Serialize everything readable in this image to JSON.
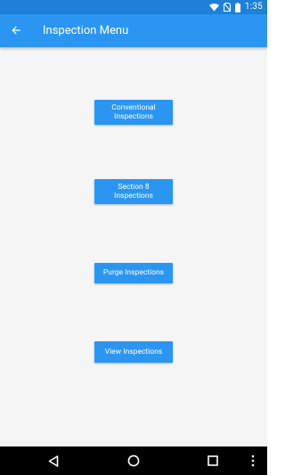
{
  "status_bar": {
    "time": "1:35",
    "icons": [
      "wifi-icon",
      "no-sim-icon",
      "battery-icon"
    ]
  },
  "app_bar": {
    "title": "Inspection Menu",
    "back_icon": "arrow-left-icon"
  },
  "menu": {
    "buttons": [
      {
        "label": "Conventional Inspections"
      },
      {
        "label": "Section 8 Inspections"
      },
      {
        "label": "Purge Inspections"
      },
      {
        "label": "View Inspections"
      }
    ]
  },
  "nav_bar": {
    "icons": [
      "back-triangle-icon",
      "home-circle-icon",
      "recents-square-icon",
      "more-vert-icon"
    ]
  },
  "colors": {
    "status_bar": "#1e80d8",
    "app_bar": "#2a96f2",
    "button": "#2a96f2",
    "background": "#f5f5f5",
    "nav_bar": "#000000"
  }
}
